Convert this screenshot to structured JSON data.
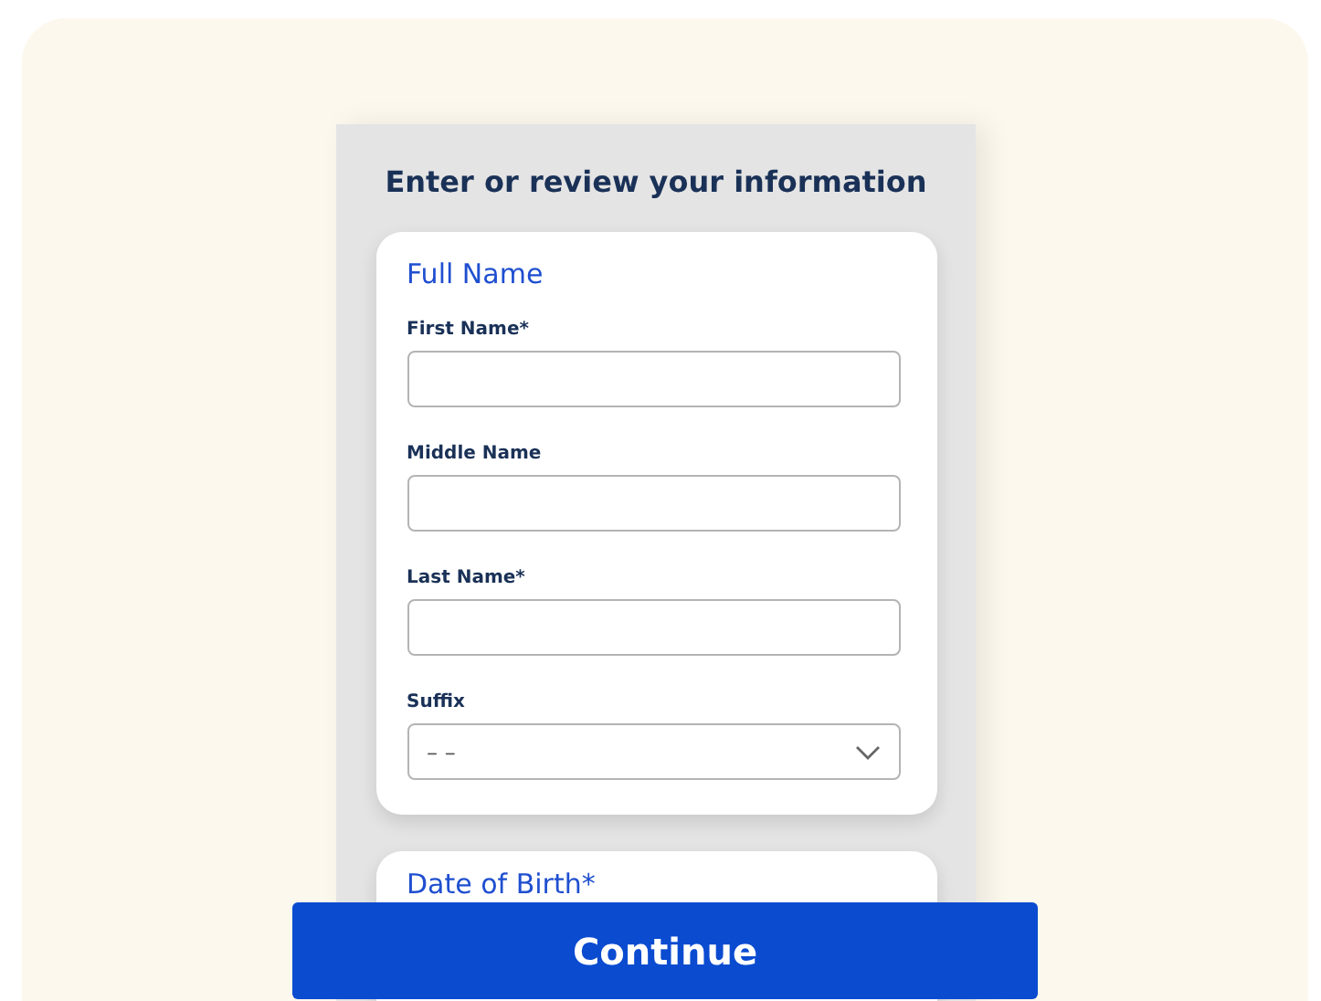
{
  "heading": "Enter or review your information",
  "sections": [
    {
      "title": "Full Name",
      "fields": [
        {
          "label": "First Name*",
          "kind": "text"
        },
        {
          "label": "Middle Name",
          "kind": "text"
        },
        {
          "label": "Last Name*",
          "kind": "text"
        },
        {
          "label": "Suffix",
          "kind": "select",
          "placeholder": "– –"
        }
      ]
    },
    {
      "title": "Date of Birth*"
    }
  ],
  "button": "Continue"
}
